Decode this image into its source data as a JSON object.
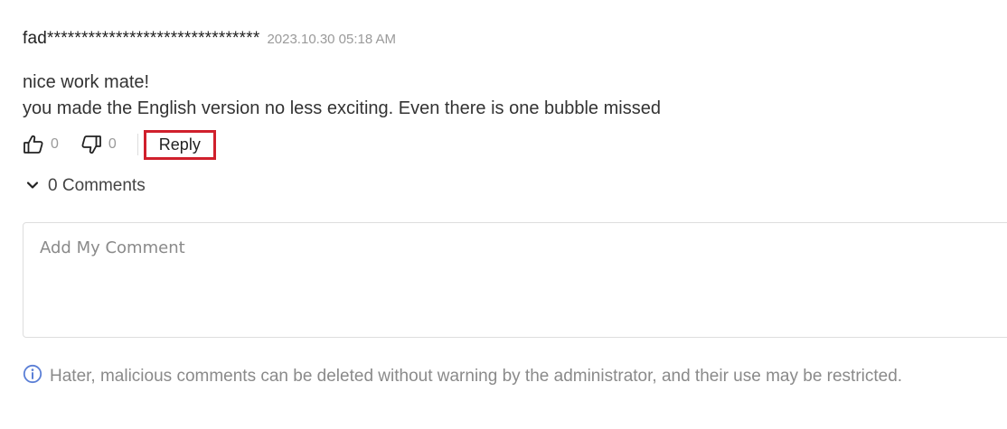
{
  "comment": {
    "author": "fad*******************************",
    "timestamp": "2023.10.30 05:18 AM",
    "lines": [
      "nice work mate!",
      "you made the English version no less exciting. Even there is one bubble missed"
    ],
    "likes": "0",
    "dislikes": "0",
    "reply_label": "Reply"
  },
  "comments_toggle": {
    "label": "0 Comments"
  },
  "comment_input": {
    "placeholder": "Add My Comment",
    "value": ""
  },
  "notice": {
    "text": "Hater, malicious comments can be deleted without warning by the administrator, and their use may be restricted."
  },
  "icons": {
    "like": "thumbs-up-icon",
    "dislike": "thumbs-down-icon",
    "toggle": "chevron-down-icon",
    "notice": "info-icon"
  },
  "colors": {
    "highlight_border": "#d0202c",
    "info_icon": "#5b7fd6"
  }
}
